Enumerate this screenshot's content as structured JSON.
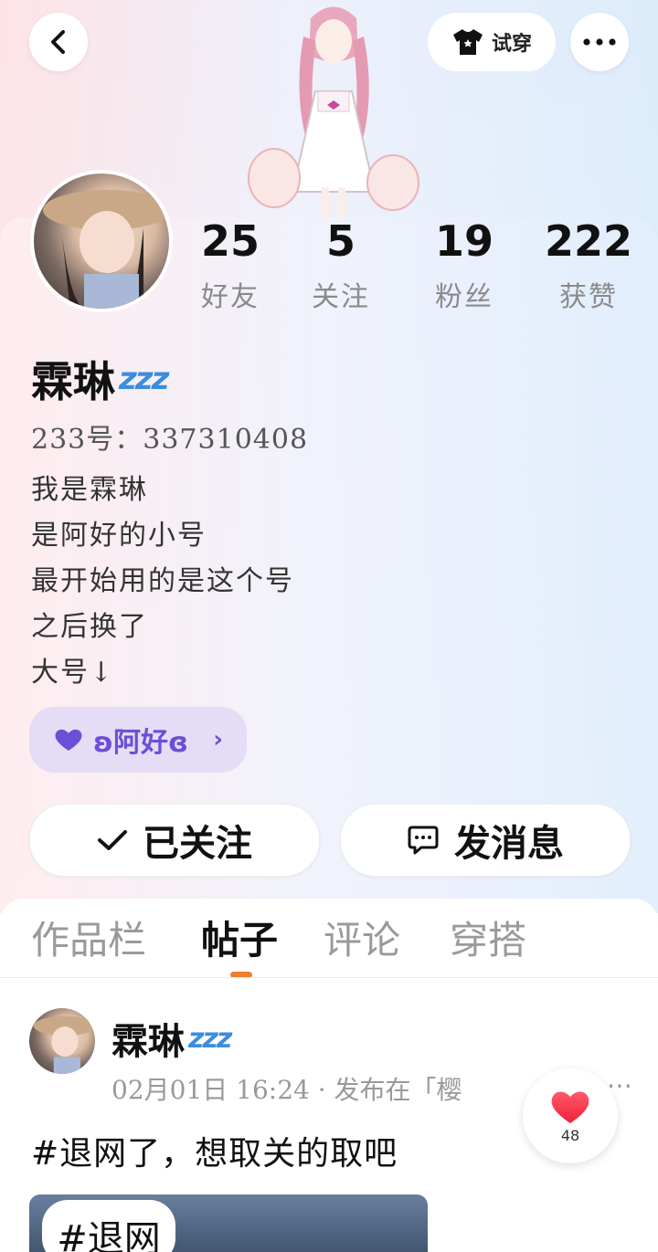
{
  "header": {
    "try_on_label": "试穿"
  },
  "stats": [
    {
      "value": "25",
      "label": "好友"
    },
    {
      "value": "5",
      "label": "关注"
    },
    {
      "value": "19",
      "label": "粉丝"
    },
    {
      "value": "222",
      "label": "获赞"
    }
  ],
  "profile": {
    "name": "霖琳",
    "name_suffix": "zzz",
    "uid": "233号：337310408",
    "bio": [
      "我是霖琳",
      "是阿好的小号",
      "最开始用的是这个号",
      "之后换了",
      "大号↓"
    ],
    "linked_account": "ʚ阿好ɞ"
  },
  "actions": {
    "follow_label": "已关注",
    "message_label": "发消息"
  },
  "tabs": [
    {
      "label": "作品栏",
      "active": false
    },
    {
      "label": "帖子",
      "active": true
    },
    {
      "label": "评论",
      "active": false
    },
    {
      "label": "穿搭",
      "active": false
    }
  ],
  "post": {
    "author": "霖琳",
    "author_suffix": "zzz",
    "meta": "02月01日 16:24 · 发布在「樱",
    "text": "#退网了，想取关的取吧",
    "image_tag": "#退网",
    "likes": "48"
  },
  "colors": {
    "accent": "#f07d2a",
    "link_chip_bg": "#e5dcf6",
    "link_chip_text": "#6b4fd6",
    "zzz": "#3a8de0",
    "heart": "#f0344a"
  },
  "icons": [
    "back-icon",
    "shirt-icon",
    "more-icon",
    "heart-icon",
    "check-icon",
    "chat-icon",
    "chevron-right-icon",
    "heart-fab-icon"
  ]
}
